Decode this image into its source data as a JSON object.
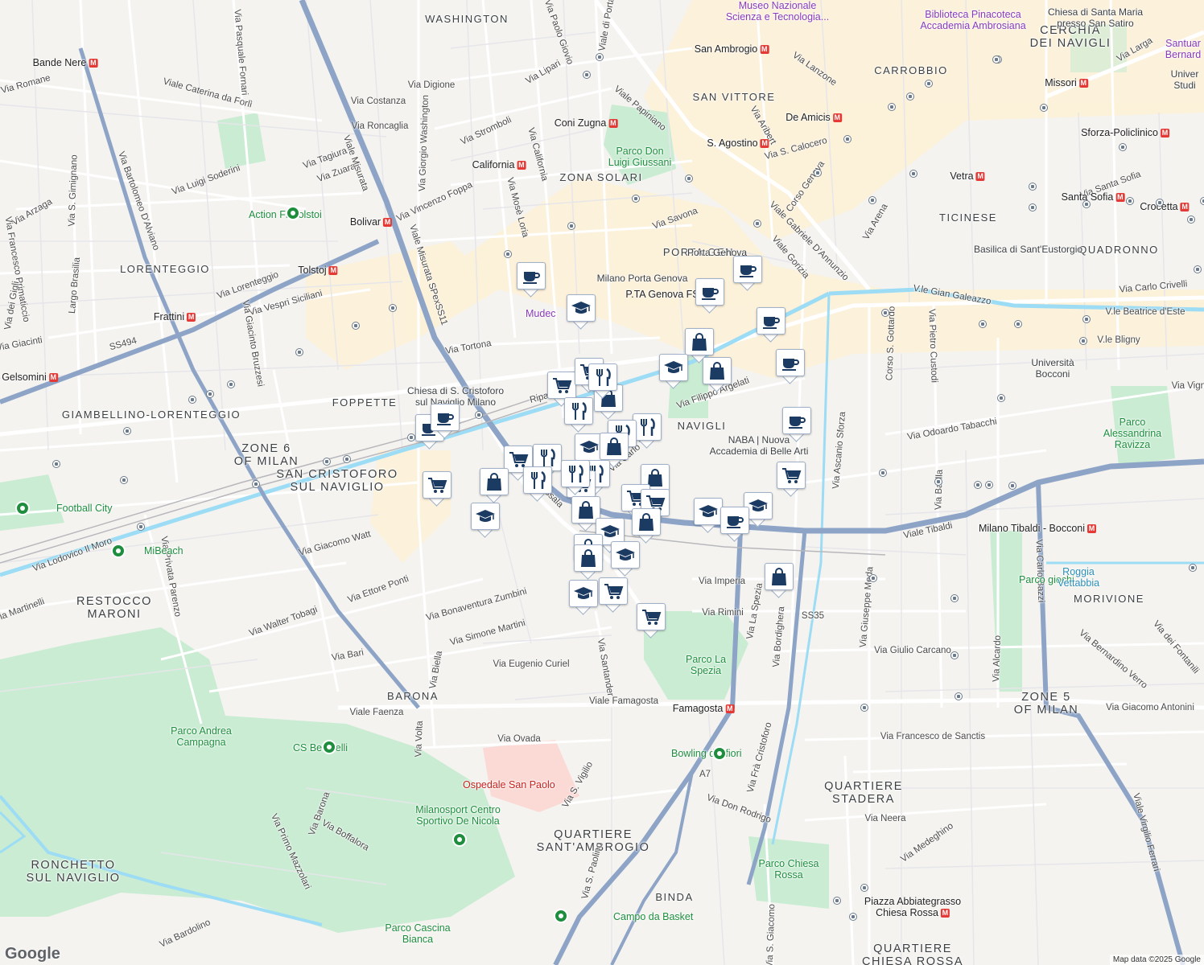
{
  "map": {
    "attribution": "Map data ©2025 Google",
    "logo_text": "Google",
    "colors": {
      "background": "#f4f3f0",
      "park": "#c9ecd3",
      "water": "#9cdcf5",
      "highway": "#8da4c7",
      "commercial_area": "#fdf1d7",
      "hospital_area": "#fbdad6",
      "marker_icon": "#1c3b63"
    }
  },
  "districts": [
    {
      "text": "WASHINGTON"
    },
    {
      "text": "SAN VITTORE"
    },
    {
      "text": "CARROBBIO"
    },
    {
      "text": "CERCHIA\nDEI NAVIGLI"
    },
    {
      "text": "ZONA SOLARI"
    },
    {
      "text": "PORTA GEN"
    },
    {
      "text": "TICINESE"
    },
    {
      "text": "QUADRONNO"
    },
    {
      "text": "LORENTEGGIO"
    },
    {
      "text": "FOPPETTE"
    },
    {
      "text": "GIAMBELLINO-LORENTEGGIO"
    },
    {
      "text": "ZONE 6\nOF MILAN"
    },
    {
      "text": "SAN CRISTOFORO\nSUL NAVIGLIO"
    },
    {
      "text": "NAVIGLI"
    },
    {
      "text": "RESTOCCO\nMARONI"
    },
    {
      "text": "MORIVIONE"
    },
    {
      "text": "BARONA"
    },
    {
      "text": "ZONE 5\nOF MILAN"
    },
    {
      "text": "QUARTIERE\nSTADERA"
    },
    {
      "text": "QUARTIERE\nSANT'AMBROGIO"
    },
    {
      "text": "BINDA"
    },
    {
      "text": "RONCHETTO\nSUL NAVIGLIO"
    },
    {
      "text": "QUARTIERE\nCHIESA ROSSA"
    }
  ],
  "streets": [
    {
      "text": "Via Costanza"
    },
    {
      "text": "Via Roncaglia"
    },
    {
      "text": "Via Digione"
    },
    {
      "text": "Via Lipari"
    },
    {
      "text": "Via Paolo Giovio"
    },
    {
      "text": "Viale di Porta"
    },
    {
      "text": "Viale Papiniano"
    },
    {
      "text": "Via Lanzone"
    },
    {
      "text": "Via Arena"
    },
    {
      "text": "Viale Caterina da Forlì"
    },
    {
      "text": "Via Pasquale Fornari"
    },
    {
      "text": "Via Stromboli"
    },
    {
      "text": "Via California"
    },
    {
      "text": "Via Tagiura"
    },
    {
      "text": "Via Zuara"
    },
    {
      "text": "Via Luigi Soderini"
    },
    {
      "text": "Via Giorgio Washington"
    },
    {
      "text": "Viale Misurata"
    },
    {
      "text": "Via Vincenzo Foppa"
    },
    {
      "text": "Via Mosè Loria"
    },
    {
      "text": "Via Arzaga"
    },
    {
      "text": "Via S. Gimignano"
    },
    {
      "text": "Via Bartolomeo D'Alviano"
    },
    {
      "text": "Via Savona"
    },
    {
      "text": "Via Aribert"
    },
    {
      "text": "Via S. Calocero"
    },
    {
      "text": "Corso Genova"
    },
    {
      "text": "Viale Gabriele D'Annunzio"
    },
    {
      "text": "Viale Gorizia"
    },
    {
      "text": "V.le Gian Galeazzo"
    },
    {
      "text": "Via Carlo Crivelli"
    },
    {
      "text": "V.le Beatrice d'Este"
    },
    {
      "text": "V.le Bligny"
    },
    {
      "text": "Via Santa Sofia"
    },
    {
      "text": "Via Larga"
    },
    {
      "text": "Via Lorenteggio"
    },
    {
      "text": "Via Vespri Siciliani"
    },
    {
      "text": "Largo Brasilia"
    },
    {
      "text": "Via Giacinto Bruzzesi"
    },
    {
      "text": "Viale Misurata SPexSS11"
    },
    {
      "text": "Via Tortona"
    },
    {
      "text": "Ripa"
    },
    {
      "text": "Via Filippo Argelati"
    },
    {
      "text": "Via Ascanio Sforza"
    },
    {
      "text": "Corso S. Gottardo"
    },
    {
      "text": "Via Pietro Custodi"
    },
    {
      "text": "Via Odoardo Tabacchi"
    },
    {
      "text": "Via Vigno"
    },
    {
      "text": "Via Balilla"
    },
    {
      "text": "Viale Tibaldi"
    },
    {
      "text": "Via Carlo Bazzi"
    },
    {
      "text": "Via Lodovico Il Moro"
    },
    {
      "text": "Via Giacomo Watt"
    },
    {
      "text": "Via Cassala"
    },
    {
      "text": "Via Carlo To"
    },
    {
      "text": "Via Ettore Ponti"
    },
    {
      "text": "Via Imperia"
    },
    {
      "text": "Via Rimini"
    },
    {
      "text": "Via La Spezia"
    },
    {
      "text": "Via Bordighera"
    },
    {
      "text": "Via Giuseppe Meda"
    },
    {
      "text": "Via Giulio Carcano"
    },
    {
      "text": "Via Alcardo"
    },
    {
      "text": "Via Bernardino Verro"
    },
    {
      "text": "Via dei Fontanili"
    },
    {
      "text": "Via Walter Tobagi"
    },
    {
      "text": "Via Bonaventura Zumbini"
    },
    {
      "text": "Via Simone Martini"
    },
    {
      "text": "Via Bari"
    },
    {
      "text": "Via Biella"
    },
    {
      "text": "Via Eugenio Curiel"
    },
    {
      "text": "Via Santander"
    },
    {
      "text": "Viale Faenza"
    },
    {
      "text": "Viale Famagosta"
    },
    {
      "text": "Via Giacomo Antonini"
    },
    {
      "text": "Via Volta"
    },
    {
      "text": "Via Ovada"
    },
    {
      "text": "Via S. Vigilio"
    },
    {
      "text": "Via Don Rodrigo"
    },
    {
      "text": "Via Frà Cristoforo"
    },
    {
      "text": "Via Francesco de Sanctis"
    },
    {
      "text": "Via Neera"
    },
    {
      "text": "Via Medeghino"
    },
    {
      "text": "Viale Virgilio Ferrari"
    },
    {
      "text": "Via Barona"
    },
    {
      "text": "Via Boffalora"
    },
    {
      "text": "Via Primo Mazzolari"
    },
    {
      "text": "Via Bardolino"
    },
    {
      "text": "Via S. Paolino"
    },
    {
      "text": "Via Privata Parenzo"
    },
    {
      "text": "Via Martinelli"
    },
    {
      "text": "Via Francesco Primaticcio"
    },
    {
      "text": "Via dei Gigli"
    },
    {
      "text": "Via Giacinti"
    },
    {
      "text": "Via Romane"
    },
    {
      "text": "Via S. Giacomo"
    },
    {
      "text": "SS494"
    },
    {
      "text": "SS35"
    },
    {
      "text": "A7"
    }
  ],
  "metro": [
    {
      "text": "Bande Nere"
    },
    {
      "text": "San Ambrogio"
    },
    {
      "text": "Missori"
    },
    {
      "text": "De Amicis"
    },
    {
      "text": "Coni Zugna"
    },
    {
      "text": "S. Agostino"
    },
    {
      "text": "California"
    },
    {
      "text": "Sforza-Policlinico"
    },
    {
      "text": "Vetra"
    },
    {
      "text": "Santa Sofia"
    },
    {
      "text": "Crocetta"
    },
    {
      "text": "Bolivar"
    },
    {
      "text": "Tolstoj"
    },
    {
      "text": "Frattini"
    },
    {
      "text": "Gelsomini"
    },
    {
      "text": "P.TA Genova FS"
    },
    {
      "text": "Famagosta"
    },
    {
      "text": "Piazza Abbiategrasso\nChiesa Rossa"
    },
    {
      "text": "Milano Tibaldi - Bocconi"
    }
  ],
  "places": [
    {
      "text": "Museo Nazionale\nScienza e Tecnologia...",
      "kind": "museum"
    },
    {
      "text": "Biblioteca Pinacoteca\nAccademia Ambrosiana",
      "kind": "museum"
    },
    {
      "text": "Chiesa di Santa Maria\npresso San Satiro",
      "kind": "plain"
    },
    {
      "text": "Santuar\nBernard",
      "kind": "museum"
    },
    {
      "text": "Univer\nStudi",
      "kind": "plain"
    },
    {
      "text": "Parco Don\nLuigi Giussani",
      "kind": "park"
    },
    {
      "text": "Action Fit Tolstoi",
      "kind": "park"
    },
    {
      "text": "Milano Porta Genova",
      "kind": "plain"
    },
    {
      "text": "Mudec",
      "kind": "museum"
    },
    {
      "text": "Basilica di Sant'Eustorgio",
      "kind": "plain"
    },
    {
      "text": "Chiesa di S. Cristoforo\nsul Naviglio Milano",
      "kind": "plain"
    },
    {
      "text": "Università\nBocconi",
      "kind": "plain"
    },
    {
      "text": "Parco\nAlessandrina\nRavizza",
      "kind": "park"
    },
    {
      "text": "NABA | Nuova\nAccademia di Belle Arti",
      "kind": "plain"
    },
    {
      "text": "Football City",
      "kind": "park"
    },
    {
      "text": "MiBeach",
      "kind": "park"
    },
    {
      "text": "Parco giochi",
      "kind": "park"
    },
    {
      "text": "Roggia\nVettabbia",
      "kind": "water"
    },
    {
      "text": "Parco La\nSpezia",
      "kind": "park"
    },
    {
      "text": "Parco Andrea\nCampagna",
      "kind": "park"
    },
    {
      "text": "CS Bettinelli",
      "kind": "park"
    },
    {
      "text": "Bowling dei fiori",
      "kind": "park"
    },
    {
      "text": "Ospedale San Paolo",
      "kind": "hospital"
    },
    {
      "text": "Milanosport Centro\nSportivo De Nicola",
      "kind": "park"
    },
    {
      "text": "Parco Chiesa\nRossa",
      "kind": "park"
    },
    {
      "text": "Campo da Basket",
      "kind": "park"
    },
    {
      "text": "Parco Cascina\nBianca",
      "kind": "park"
    },
    {
      "text": "Porta Genova",
      "kind": "plain"
    }
  ],
  "markers": [
    {
      "type": "cafe"
    },
    {
      "type": "education"
    },
    {
      "type": "cafe"
    },
    {
      "type": "cafe"
    },
    {
      "type": "cafe"
    },
    {
      "type": "cafe"
    },
    {
      "type": "shop"
    },
    {
      "type": "education"
    },
    {
      "type": "shop"
    },
    {
      "type": "cafe"
    },
    {
      "type": "grocery"
    },
    {
      "type": "grocery"
    },
    {
      "type": "restaurant"
    },
    {
      "type": "shop"
    },
    {
      "type": "restaurant"
    },
    {
      "type": "cafe"
    },
    {
      "type": "cafe"
    },
    {
      "type": "restaurant"
    },
    {
      "type": "restaurant"
    },
    {
      "type": "education"
    },
    {
      "type": "shop"
    },
    {
      "type": "restaurant"
    },
    {
      "type": "grocery"
    },
    {
      "type": "restaurant"
    },
    {
      "type": "restaurant"
    },
    {
      "type": "grocery"
    },
    {
      "type": "grocery"
    },
    {
      "type": "shop"
    },
    {
      "type": "restaurant"
    },
    {
      "type": "shop"
    },
    {
      "type": "grocery"
    },
    {
      "type": "shop"
    },
    {
      "type": "grocery"
    },
    {
      "type": "education"
    },
    {
      "type": "education"
    },
    {
      "type": "education"
    },
    {
      "type": "cafe"
    },
    {
      "type": "grocery"
    },
    {
      "type": "shop"
    },
    {
      "type": "education"
    },
    {
      "type": "shop"
    },
    {
      "type": "shop"
    },
    {
      "type": "education"
    },
    {
      "type": "education"
    },
    {
      "type": "grocery"
    },
    {
      "type": "grocery"
    },
    {
      "type": "shop"
    }
  ]
}
